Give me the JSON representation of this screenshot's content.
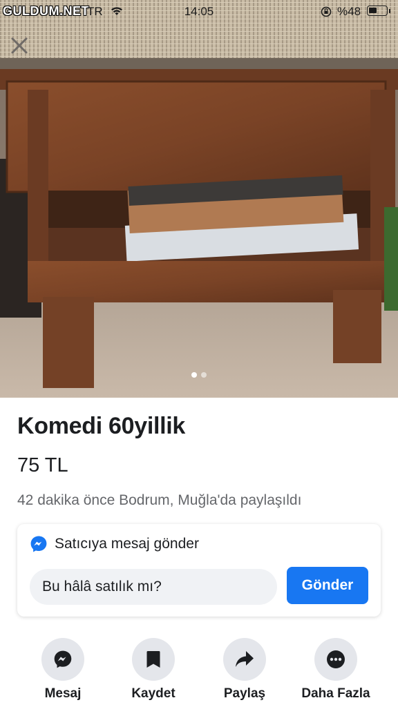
{
  "status": {
    "watermark": "GULDUM.NET",
    "carrier": "TR",
    "time": "14:05",
    "battery": "%48",
    "battery_level": 0.48
  },
  "gallery": {
    "image_count": 2,
    "active_index": 0
  },
  "listing": {
    "title": "Komedi 60yillik",
    "price": "75 TL",
    "meta": "42 dakika önce Bodrum, Muğla'da paylaşıldı"
  },
  "message": {
    "heading": "Satıcıya mesaj gönder",
    "input_value": "Bu hâlâ satılık mı?",
    "send_label": "Gönder"
  },
  "actions": [
    {
      "label": "Mesaj",
      "icon": "messenger-icon"
    },
    {
      "label": "Kaydet",
      "icon": "bookmark-icon"
    },
    {
      "label": "Paylaş",
      "icon": "share-icon"
    },
    {
      "label": "Daha Fazla",
      "icon": "more-icon"
    }
  ],
  "colors": {
    "accent": "#1877f2",
    "action_bg": "#e4e6eb",
    "input_bg": "#f0f2f5",
    "muted_text": "#65676b"
  }
}
